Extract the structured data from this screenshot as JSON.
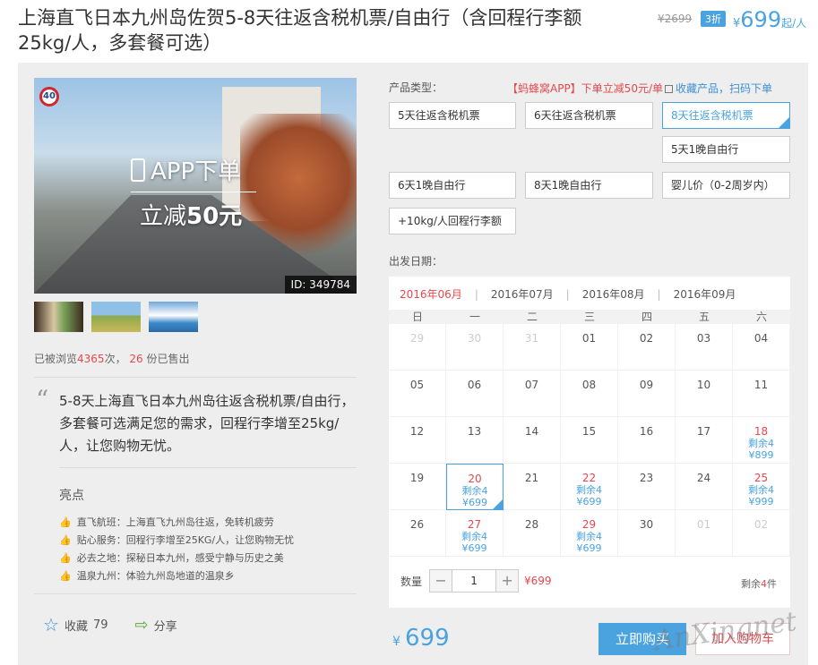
{
  "header": {
    "title": "上海直飞日本九州岛佐贺5-8天往返含税机票/自由行（含回程行李额25kg/人，多套餐可选）",
    "old_price": "¥2699",
    "discount": "3折",
    "currency": "¥",
    "price": "699",
    "unit": "起/人"
  },
  "gallery": {
    "sign_text": "40",
    "promo_line1": "APP下单",
    "promo_line2_prefix": "立减",
    "promo_line2_amount": "50元",
    "id_tag": "ID: 349784",
    "thumbnails": [
      "room-view",
      "rice-field",
      "coast-view"
    ]
  },
  "stats": {
    "prefix": "已被浏览",
    "views": "4365",
    "mid": "次，",
    "sold": "26",
    "suffix": "份已售出"
  },
  "description": "5-8天上海直飞日本九州岛往返含税机票/自由行，多套餐可选满足您的需求，回程行李增至25kg/人，让您购物无忧。",
  "highlights": {
    "title": "亮点",
    "items": [
      "直飞航班：上海直飞九州岛往返，免转机疲劳",
      "贴心服务：回程行李增至25KG/人，让您购物无忧",
      "必去之地：探秘日本九州，感受宁静与历史之美",
      "温泉九州：体验九州岛地道的温泉乡"
    ]
  },
  "actions": {
    "favorite_label": "收藏",
    "favorite_count": "79",
    "share_label": "分享"
  },
  "product": {
    "type_label": "产品类型：",
    "app_promo": "【蚂蜂窝APP】下单立减50元/单",
    "collect_text": "收藏产品，扫码下单",
    "options": [
      "5天往返含税机票",
      "6天往返含税机票",
      "8天往返含税机票",
      "5天1晚自由行",
      "6天1晚自由行",
      "8天1晚自由行",
      "婴儿价（0-2周岁内）",
      "+10kg/人回程行李额"
    ],
    "date_label": "出发日期："
  },
  "calendar": {
    "months": [
      "2016年06月",
      "2016年07月",
      "2016年08月",
      "2016年09月"
    ],
    "weekdays": [
      "日",
      "一",
      "二",
      "三",
      "四",
      "五",
      "六"
    ],
    "days": [
      {
        "d": "29",
        "dim": true
      },
      {
        "d": "30",
        "dim": true
      },
      {
        "d": "31",
        "dim": true
      },
      {
        "d": "01"
      },
      {
        "d": "02"
      },
      {
        "d": "03"
      },
      {
        "d": "04"
      },
      {
        "d": "05"
      },
      {
        "d": "06"
      },
      {
        "d": "07"
      },
      {
        "d": "08"
      },
      {
        "d": "09"
      },
      {
        "d": "10"
      },
      {
        "d": "11"
      },
      {
        "d": "12"
      },
      {
        "d": "13"
      },
      {
        "d": "14"
      },
      {
        "d": "15"
      },
      {
        "d": "16"
      },
      {
        "d": "17"
      },
      {
        "d": "18",
        "rem": "剩余4",
        "price": "¥899"
      },
      {
        "d": "19"
      },
      {
        "d": "20",
        "rem": "剩余4",
        "price": "¥699",
        "sel": true
      },
      {
        "d": "21"
      },
      {
        "d": "22",
        "rem": "剩余4",
        "price": "¥699"
      },
      {
        "d": "23"
      },
      {
        "d": "24"
      },
      {
        "d": "25",
        "rem": "剩余4",
        "price": "¥999"
      },
      {
        "d": "26"
      },
      {
        "d": "27",
        "rem": "剩余4",
        "price": "¥699"
      },
      {
        "d": "28"
      },
      {
        "d": "29",
        "rem": "剩余4",
        "price": "¥699"
      },
      {
        "d": "30"
      },
      {
        "d": "01",
        "dim": true
      },
      {
        "d": "02",
        "dim": true
      }
    ]
  },
  "order": {
    "qty_label": "数量",
    "minus": "−",
    "qty": "1",
    "plus": "+",
    "qty_price": "¥699",
    "stock_prefix": "剩余",
    "stock_count": "4",
    "stock_suffix": "件",
    "total_currency": "¥",
    "total": "699",
    "buy_label": "立即购买",
    "cart_label": "加入购物车"
  },
  "watermark": "AnXingnet"
}
